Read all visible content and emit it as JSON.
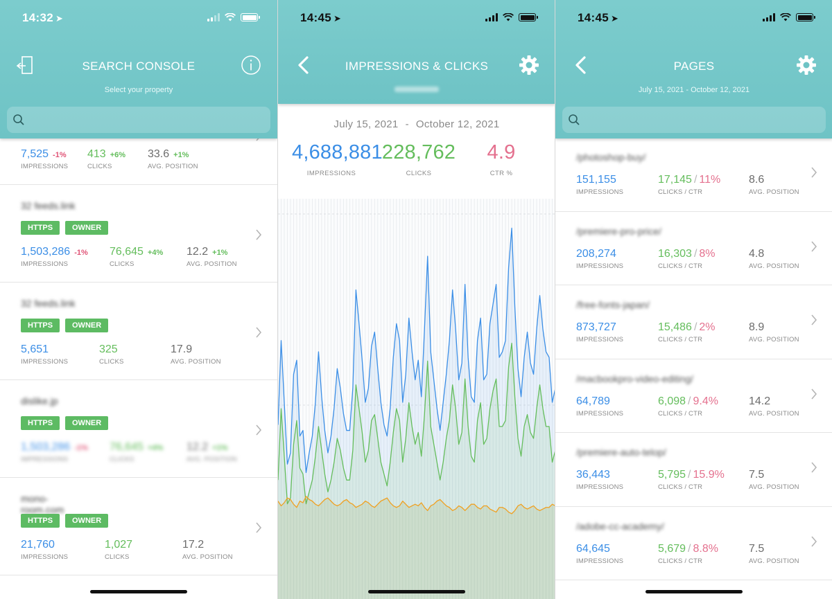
{
  "colors": {
    "header": "#6ec3c5",
    "impressions": "#3b8ee6",
    "clicks": "#64bd5c",
    "position": "#6c6c6c",
    "negative": "#e05577",
    "ctr": "#e4708e",
    "badge": "#5dbb63",
    "avg_position_line": "#f0a020"
  },
  "screen1": {
    "time": "14:32",
    "title": "SEARCH CONSOLE",
    "subtitle": "Select your property",
    "exit_icon": "exit-door-icon",
    "info_icon": "info-icon",
    "search_placeholder": "",
    "labels": {
      "impressions": "IMPRESSIONS",
      "clicks": "CLICKS",
      "position": "AVG. POSITION",
      "https": "HTTPS",
      "owner": "OWNER"
    },
    "cards": [
      {
        "name": "",
        "impressions": "7,525",
        "impressions_delta": "-1%",
        "clicks": "413",
        "clicks_delta": "+6%",
        "position": "33.6",
        "position_delta": "+1%"
      },
      {
        "name": "32 feeds.link",
        "impressions": "1,503,286",
        "impressions_delta": "-1%",
        "clicks": "76,645",
        "clicks_delta": "+4%",
        "position": "12.2",
        "position_delta": "+1%"
      },
      {
        "name": "32 feeds.link",
        "impressions": "5,651",
        "impressions_delta": "",
        "clicks": "325",
        "clicks_delta": "",
        "position": "17.9",
        "position_delta": ""
      },
      {
        "name": "dislike.jp",
        "impressions": "1,503,286",
        "impressions_delta": "-1%",
        "clicks": "76,645",
        "clicks_delta": "+4%",
        "position": "12.2",
        "position_delta": "+1%"
      },
      {
        "name": "mono-room.com",
        "impressions": "21,760",
        "impressions_delta": "",
        "clicks": "1,027",
        "clicks_delta": "",
        "position": "17.2",
        "position_delta": ""
      }
    ]
  },
  "screen2": {
    "time": "14:45",
    "title": "IMPRESSIONS & CLICKS",
    "subtitle": "",
    "date_start": "July 15, 2021",
    "date_sep": "-",
    "date_end": "October 12, 2021",
    "impressions": "4,688,881",
    "impressions_label": "IMPRESSIONS",
    "clicks": "228,762",
    "clicks_label": "CLICKS",
    "ctr": "4.9",
    "ctr_label": "CTR %"
  },
  "chart_data": {
    "type": "line",
    "x_range": [
      "July 15, 2021",
      "October 12, 2021"
    ],
    "grid": true,
    "legend": "none",
    "series": [
      {
        "values": [
          62,
          92,
          70,
          48,
          52,
          80,
          85,
          58,
          60,
          45,
          52,
          58,
          70,
          88,
          72,
          60,
          52,
          58,
          68,
          82,
          75,
          66,
          60,
          60,
          75,
          110,
          98,
          85,
          70,
          75,
          90,
          95,
          82,
          70,
          62,
          58,
          68,
          86,
          98,
          92,
          70,
          80,
          100,
          88,
          78,
          85,
          72,
          96,
          122,
          88,
          78,
          68,
          60,
          70,
          80,
          92,
          110,
          96,
          78,
          84,
          112,
          86,
          72,
          70,
          92,
          100,
          78,
          80,
          98,
          105,
          112,
          86,
          88,
          92,
          118,
          132,
          104,
          82,
          72,
          86,
          95,
          84,
          80,
          96,
          108,
          96,
          88,
          86,
          70,
          75
        ]
      },
      {
        "values": [
          20,
          32,
          24,
          16,
          17,
          26,
          30,
          22,
          21,
          16,
          18,
          20,
          24,
          29,
          25,
          21,
          18,
          20,
          23,
          27,
          25,
          22,
          20,
          20,
          25,
          36,
          32,
          28,
          23,
          25,
          30,
          31,
          27,
          23,
          21,
          19,
          23,
          28,
          32,
          30,
          23,
          27,
          33,
          29,
          26,
          28,
          24,
          31,
          40,
          29,
          26,
          23,
          20,
          23,
          27,
          30,
          36,
          32,
          26,
          28,
          37,
          29,
          24,
          23,
          30,
          33,
          26,
          27,
          32,
          35,
          37,
          29,
          29,
          30,
          39,
          43,
          34,
          27,
          24,
          29,
          31,
          28,
          27,
          32,
          36,
          32,
          29,
          29,
          23,
          25
        ]
      },
      {
        "values": [
          6.2,
          5.9,
          6.1,
          6.4,
          6.3,
          6.0,
          5.8,
          6.2,
          6.1,
          6.5,
          6.3,
          6.2,
          6.0,
          5.9,
          6.1,
          6.3,
          6.4,
          6.2,
          6.0,
          5.9,
          6.0,
          6.2,
          6.3,
          6.1,
          6.0,
          5.8,
          5.9,
          6.0,
          6.2,
          6.1,
          5.9,
          5.8,
          6.0,
          6.2,
          6.3,
          6.4,
          6.1,
          5.9,
          5.8,
          5.9,
          6.2,
          6.0,
          5.8,
          5.9,
          6.0,
          5.9,
          6.1,
          5.8,
          5.6,
          5.9,
          6.0,
          6.2,
          6.3,
          6.1,
          5.9,
          5.8,
          5.6,
          5.7,
          5.9,
          5.8,
          5.6,
          5.8,
          6.0,
          6.0,
          5.8,
          5.7,
          5.9,
          5.9,
          5.7,
          5.6,
          5.5,
          5.8,
          5.8,
          5.7,
          5.5,
          5.4,
          5.6,
          5.9,
          6.0,
          5.8,
          5.7,
          5.8,
          5.9,
          5.7,
          5.6,
          5.7,
          5.8,
          5.8,
          6.0,
          5.9
        ]
      }
    ]
  },
  "screen3": {
    "time": "14:45",
    "title": "PAGES",
    "subtitle": "July 15, 2021 - October 12, 2021",
    "search_placeholder": "",
    "labels": {
      "impressions": "IMPRESSIONS",
      "clicks_ctr": "CLICKS / CTR",
      "position": "AVG. POSITION"
    },
    "rows": [
      {
        "url": "/photoshop-buy/",
        "impressions": "151,155",
        "clicks": "17,145",
        "ctr": "11%",
        "position": "8.6"
      },
      {
        "url": "/premiere-pro-price/",
        "impressions": "208,274",
        "clicks": "16,303",
        "ctr": "8%",
        "position": "4.8"
      },
      {
        "url": "/free-fonts-japan/",
        "impressions": "873,727",
        "clicks": "15,486",
        "ctr": "2%",
        "position": "8.9"
      },
      {
        "url": "/macbookpro-video-editing/",
        "impressions": "64,789",
        "clicks": "6,098",
        "ctr": "9.4%",
        "position": "14.2"
      },
      {
        "url": "/premiere-auto-telop/",
        "impressions": "36,443",
        "clicks": "5,795",
        "ctr": "15.9%",
        "position": "7.5"
      },
      {
        "url": "/adobe-cc-academy/",
        "impressions": "64,645",
        "clicks": "5,679",
        "ctr": "8.8%",
        "position": "7.5"
      }
    ]
  }
}
